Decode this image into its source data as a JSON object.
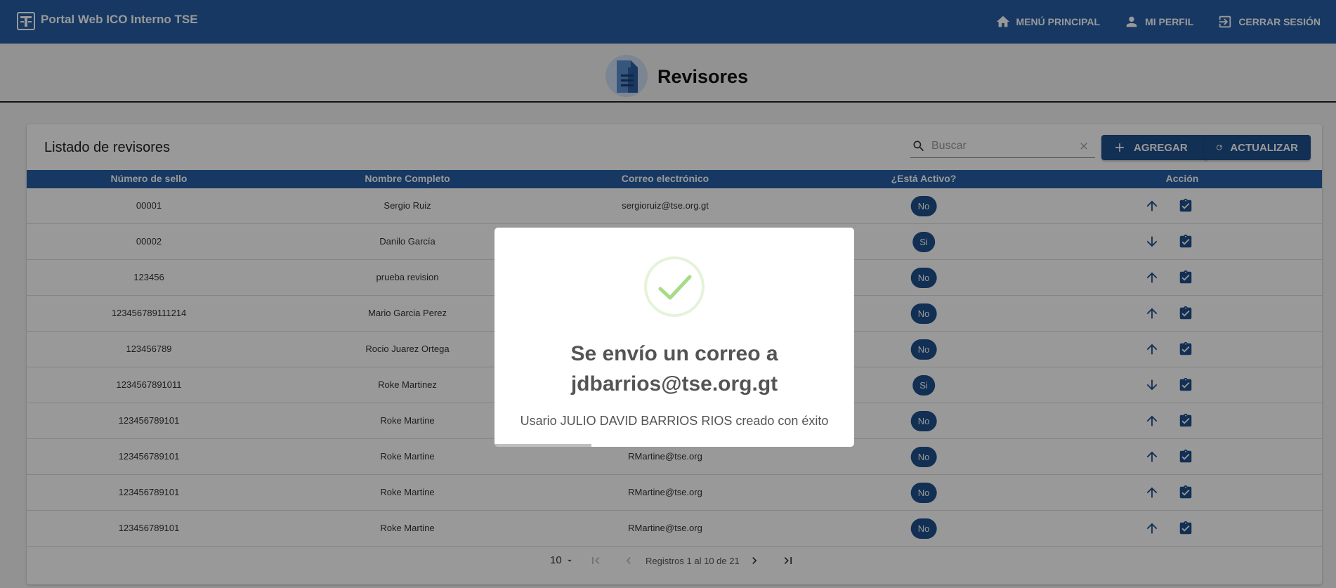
{
  "app": {
    "title": "Portal Web ICO Interno TSE"
  },
  "nav": {
    "home": "MENÚ PRINCIPAL",
    "profile": "MI PERFIL",
    "logout": "CERRAR SESIÓN"
  },
  "page": {
    "title": "Revisores"
  },
  "card": {
    "title": "Listado de revisores",
    "search_placeholder": "Buscar",
    "add_label": "AGREGAR",
    "refresh_label": "ACTUALIZAR"
  },
  "table": {
    "headers": [
      "Número de sello",
      "Nombre Completo",
      "Correo electrónico",
      "¿Está Activo?",
      "Acción"
    ],
    "rows": [
      {
        "sello": "00001",
        "nombre": "Sergio Ruiz",
        "correo": "sergioruiz@tse.org.gt",
        "activo": "No",
        "arrow": "up"
      },
      {
        "sello": "00002",
        "nombre": "Danilo García",
        "correo": "",
        "activo": "Si",
        "arrow": "down"
      },
      {
        "sello": "123456",
        "nombre": "prueba revision",
        "correo": "",
        "activo": "No",
        "arrow": "up"
      },
      {
        "sello": "123456789111214",
        "nombre": "Mario Garcia Perez",
        "correo": "",
        "activo": "No",
        "arrow": "up"
      },
      {
        "sello": "123456789",
        "nombre": "Rocio Juarez Ortega",
        "correo": "",
        "activo": "No",
        "arrow": "up"
      },
      {
        "sello": "1234567891011",
        "nombre": "Roke Martinez",
        "correo": "",
        "activo": "Si",
        "arrow": "down"
      },
      {
        "sello": "123456789101",
        "nombre": "Roke Martine",
        "correo": "",
        "activo": "No",
        "arrow": "up"
      },
      {
        "sello": "123456789101",
        "nombre": "Roke Martine",
        "correo": "RMartine@tse.org",
        "activo": "No",
        "arrow": "up"
      },
      {
        "sello": "123456789101",
        "nombre": "Roke Martine",
        "correo": "RMartine@tse.org",
        "activo": "No",
        "arrow": "up"
      },
      {
        "sello": "123456789101",
        "nombre": "Roke Martine",
        "correo": "RMartine@tse.org",
        "activo": "No",
        "arrow": "up"
      }
    ]
  },
  "pager": {
    "page_size": "10",
    "range_text": "Registros 1 al 10 de 21"
  },
  "modal": {
    "title_line1": "Se envío un correo a",
    "title_line2": "jdbarrios@tse.org.gt",
    "text": "Usario JULIO DAVID BARRIOS RIOS creado con éxito",
    "timer_progress": 0.27
  },
  "colors": {
    "primary": "#255ea6",
    "button": "#1f4f8c",
    "success": "#a5dc86"
  }
}
